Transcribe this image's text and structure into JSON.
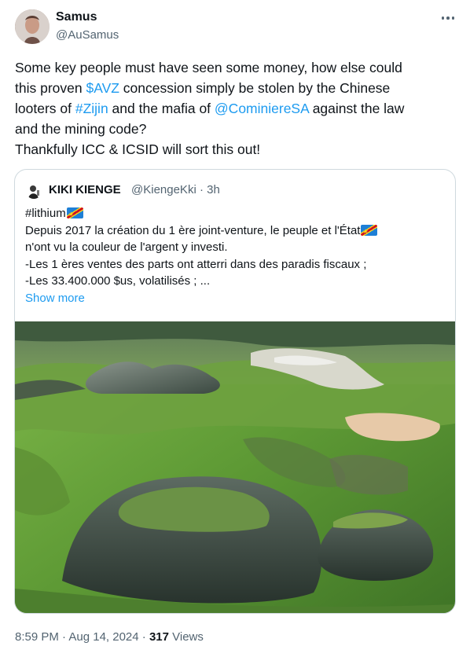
{
  "author": {
    "display_name": "Samus",
    "handle": "@AuSamus"
  },
  "tweet": {
    "text_1a": "Some key people must have seen some money, how else could",
    "text_2a": "this proven ",
    "cashtag_avz": "$AVZ",
    "text_2b": " concession simply be stolen by the Chinese",
    "text_3a": "looters of ",
    "hashtag_zijin": "#Zijin",
    "text_3b": " and the mafia of ",
    "mention_cominiere": "@CominiereSA",
    "text_3c": " against the law",
    "text_4a": "and the mining code?",
    "text_5a": "Thankfully ICC & ICSID will sort this out!"
  },
  "quote": {
    "display_name": "KIKI KIENGE",
    "meta": "@KiengeKki · 3h",
    "hashtag": "#lithium",
    "line_2": "Depuis 2017 la création du 1 ère joint-venture, le peuple et l'État",
    "line_3": "n'ont vu la couleur de l'argent y investi.",
    "line_4": "-Les 1 ères ventes des parts ont atterri dans des paradis fiscaux ;",
    "line_5": "-Les 33.400.000 $us, volatilisés ; ...",
    "show_more": "Show more"
  },
  "footer": {
    "time_date": "8:59 PM · Aug 14, 2024 · ",
    "views_count": "317",
    "views_label": " Views"
  },
  "icons": {
    "more": "more-horizontal-icon",
    "flag": "drc-flag-icon"
  },
  "colors": {
    "link": "#1d9bf0",
    "secondary_text": "#536471",
    "border": "#cfd9de"
  }
}
